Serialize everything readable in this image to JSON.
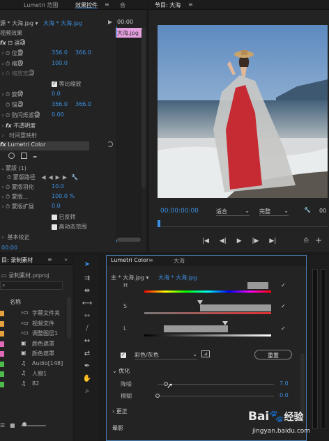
{
  "effect_panel": {
    "tabs": [
      "Lumetri 范围",
      "效果控件",
      "音"
    ],
    "source_label": "源 * 大海.jpg",
    "sequence_label": "大海 * 大海.jpg",
    "clip_label": "大海.jpg",
    "time_head": "00:00",
    "section_video": "视频效果",
    "motion_label": "运动",
    "position_label": "位置",
    "position_x": "356.0",
    "position_y": "366.0",
    "scale_label": "缩放",
    "scale_value": "100.0",
    "scale_width_label": "缩放宽度",
    "uniform_scale_label": "等比缩放",
    "rotation_label": "旋转",
    "rotation_value": "0.0",
    "anchor_label": "锚点",
    "anchor_x": "356.0",
    "anchor_y": "366.0",
    "antiflicker_label": "防闪烁滤镜",
    "antiflicker_value": "0.00",
    "opacity_label": "不透明度",
    "timeremap_label": "时间重映射",
    "lumetri_label": "Lumetri Color",
    "mask_label": "蒙版 (1)",
    "mask_path_label": "蒙版路径",
    "mask_feather_label": "蒙版羽化",
    "mask_feather_value": "10.0",
    "mask_opacity_label": "蒙版...",
    "mask_opacity_value": "100.0 %",
    "mask_expand_label": "蒙版扩展",
    "mask_expand_value": "0.0",
    "inverted_label": "已反转",
    "hq_label": "高动态范围",
    "basic_correction_label": "基本校正",
    "timecode_bottom": "00:00"
  },
  "program": {
    "title": "节目: 大海",
    "timecode": "00:00:00:00",
    "fit_label": "适合",
    "quality_label": "完整",
    "right_code": "00"
  },
  "project": {
    "title": "目: 录制素材",
    "file_label": "录制素材.prproj",
    "col_name": "名称",
    "items": [
      {
        "name": "字幕文件夹",
        "color": "#e6a23c",
        "icon": "folder-icon"
      },
      {
        "name": "视频文件",
        "color": "#e6a23c",
        "icon": "folder-icon"
      },
      {
        "name": "调整图层1",
        "color": "#e6a23c",
        "icon": "folder-icon"
      },
      {
        "name": "颜色遮罩",
        "color": "#e06ab8",
        "icon": "matte-icon"
      },
      {
        "name": "颜色遮罩",
        "color": "#e06ab8",
        "icon": "matte-icon"
      },
      {
        "name": "Audio[148]",
        "color": "#4cbb4c",
        "icon": "audio-icon"
      },
      {
        "name": "人物1",
        "color": "#4cbb4c",
        "icon": "audio-icon"
      },
      {
        "name": "82",
        "color": "#4cbb4c",
        "icon": "audio-icon"
      }
    ]
  },
  "lumetri": {
    "tabs": [
      "Lumetri Color",
      "大海"
    ],
    "source_label": "主 * 大海.jpg",
    "clip_label": "大海 * 大海.jpg",
    "h_label": "H",
    "s_label": "S",
    "l_label": "L",
    "colorgray_label": "彩色/灰色",
    "reset_label": "重置",
    "refine_label": "优化",
    "denoise_label": "降噪",
    "denoise_value": "7.0",
    "blur_label": "模糊",
    "blur_value": "0.0",
    "correct_label": "更正",
    "shadow_label": "晕影"
  },
  "watermark": {
    "brand": "Bai",
    "brand2": "经验",
    "url": "jingyan.baidu.com"
  }
}
